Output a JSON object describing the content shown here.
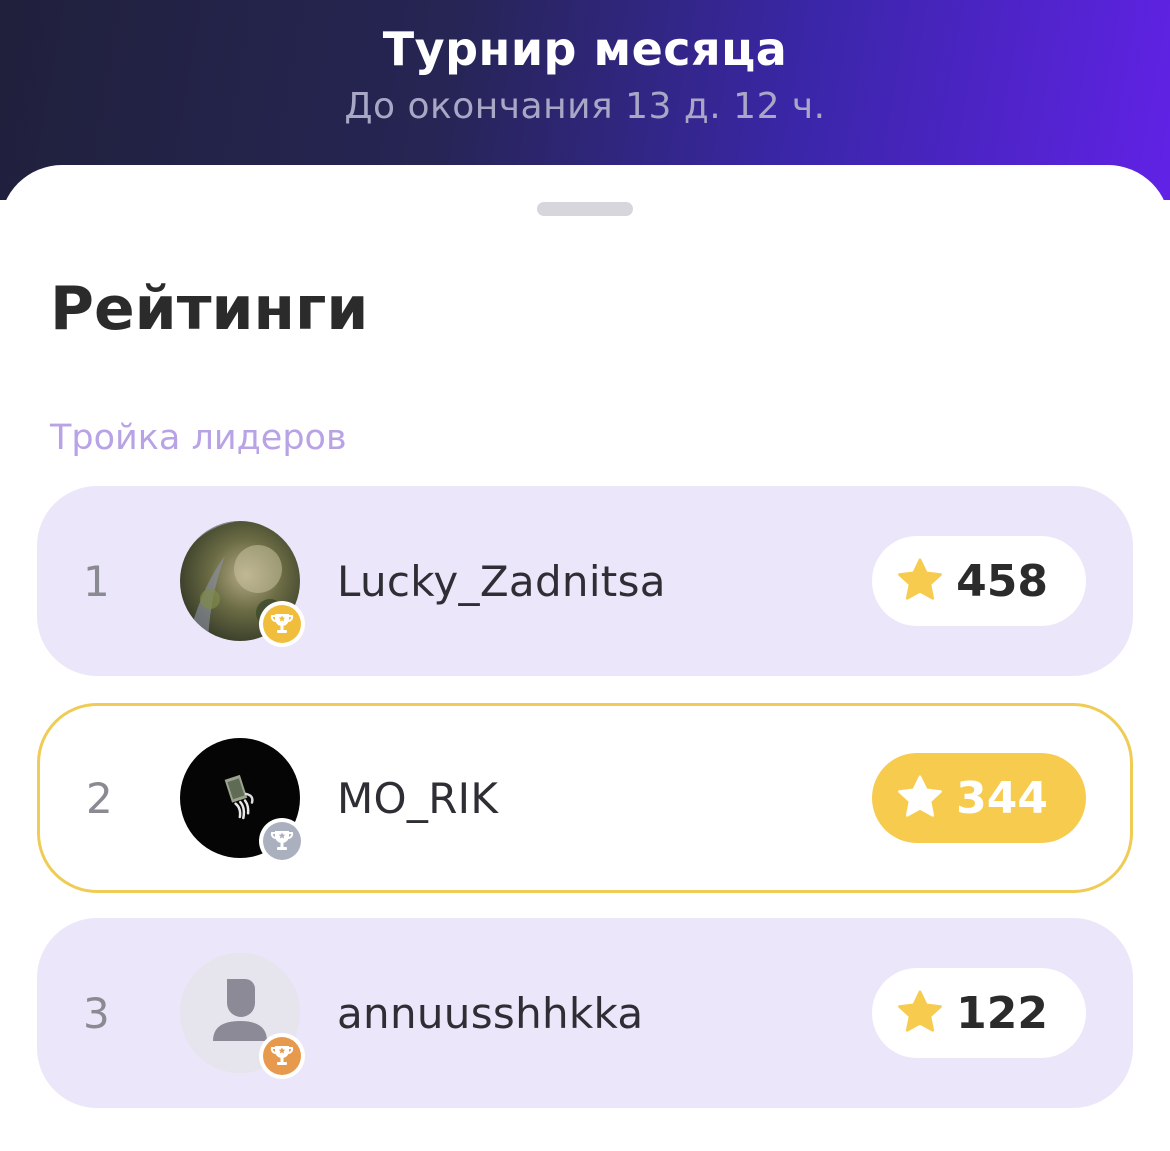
{
  "header": {
    "title": "Турнир месяца",
    "subtitle": "До окончания 13 д. 12 ч."
  },
  "ratings": {
    "title": "Рейтинги",
    "leaders_label": "Тройка лидеров",
    "rows": [
      {
        "rank": "1",
        "username": "Lucky_Zadnitsa",
        "score": "458",
        "trophy": "gold-trophy-icon",
        "avatar": "photo-avatar",
        "current_user": false
      },
      {
        "rank": "2",
        "username": "MO_RIK",
        "score": "344",
        "trophy": "silver-trophy-icon",
        "avatar": "photo-avatar",
        "current_user": true
      },
      {
        "rank": "3",
        "username": "annuusshhkka",
        "score": "122",
        "trophy": "bronze-trophy-icon",
        "avatar": "default-user-avatar",
        "current_user": false
      }
    ]
  },
  "colors": {
    "accent_purple": "#6122e6",
    "row_background": "#ece6fa",
    "highlight_yellow": "#f6cb4e",
    "leaders_label": "#b8a3e6",
    "star": "#f6cb4e"
  }
}
